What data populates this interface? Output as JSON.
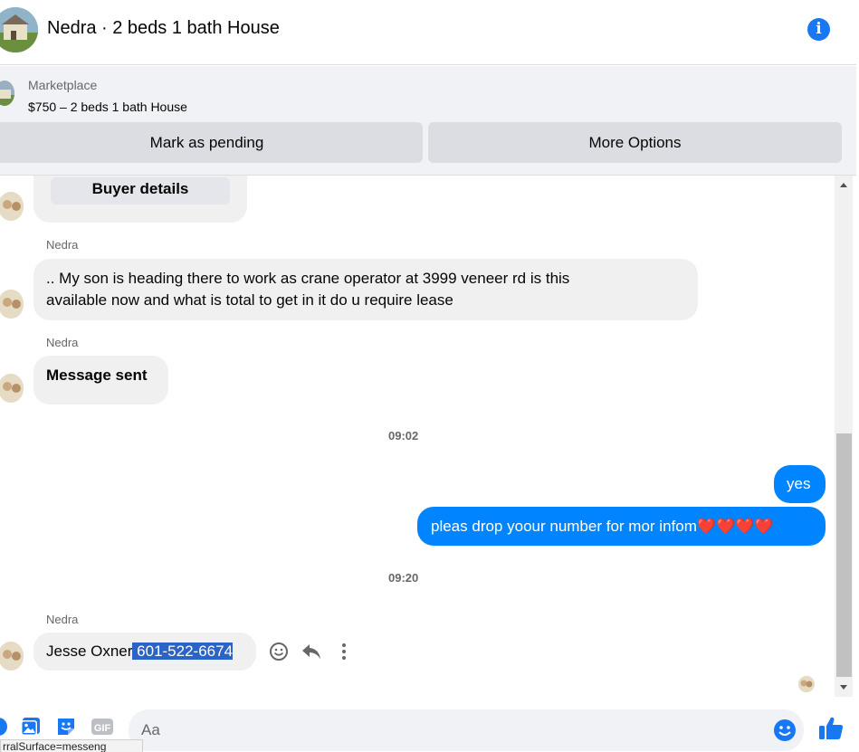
{
  "header": {
    "title": "Nedra · 2 beds 1 bath House",
    "info_symbol": "i"
  },
  "marketplace": {
    "label": "Marketplace",
    "listing": "$750 – 2 beds 1 bath House",
    "mark_pending_label": "Mark as pending",
    "more_options_label": "More Options"
  },
  "messages": {
    "buyer_details_label": "Buyer details",
    "msg1": {
      "sender": "Nedra",
      "line1": ".. My son is heading there to work as crane operator at 3999 veneer rd  is this",
      "line2": "available now and what is total to get in it do u require lease"
    },
    "msg2": {
      "sender": "Nedra",
      "text": "Message sent"
    },
    "time1": "09:02",
    "out1": "yes",
    "out2": "pleas drop yoour number for mor infom❤️❤️❤️❤️",
    "time2": "09:20",
    "msg3": {
      "sender": "Nedra",
      "text_plain": "Jesse Oxner",
      "text_selected": " 601-522-6674"
    }
  },
  "composer": {
    "placeholder": "Aa",
    "gif_label": "GIF"
  },
  "status_tooltip": "rralSurface=messeng",
  "colors": {
    "accent": "#0084ff",
    "brand": "#1877f2",
    "incoming_bubble": "#f0f0f0",
    "panel_bg": "#f0f2f5",
    "selection": "#2b63c6"
  },
  "icons": {
    "info": "info-icon",
    "emoji_reaction": "smiley-icon",
    "reply": "reply-icon",
    "more": "more-vertical-icon",
    "photo": "photo-icon",
    "sticker": "sticker-icon",
    "gif": "gif-icon",
    "emoji": "emoji-icon",
    "like": "thumbs-up-icon"
  }
}
